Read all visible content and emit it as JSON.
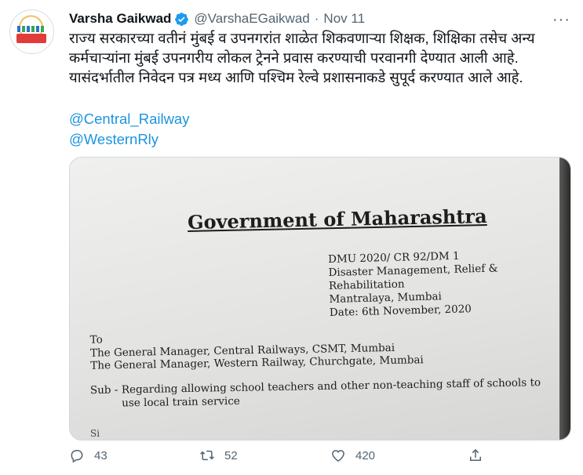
{
  "tweet": {
    "author_name": "Varsha Gaikwad",
    "handle": "@VarshaEGaikwad",
    "separator": "·",
    "date": "Nov 11",
    "more": "···",
    "text": "राज्य सरकारच्या वतीनं मुंबई व उपनगरांत शाळेत शिकवणाऱ्या शिक्षक, शिक्षिका तसेच अन्य कर्मचाऱ्यांना मुंबई उपनगरीय लोकल ट्रेनने प्रवास करण्याची परवानगी देण्यात आली आहे. यासंदर्भातील निवेदन पत्र मध्य आणि पश्चिम रेल्वे प्रशासनाकडे सुपूर्द करण्यात आले आहे.",
    "mentions": [
      "@Central_Railway",
      "@WesternRly"
    ]
  },
  "document": {
    "title": "Government of Maharashtra",
    "ref_lines": [
      "DMU 2020/ CR 92/DM 1",
      "Disaster Management, Relief & Rehabilitation",
      "Mantralaya, Mumbai",
      "Date:  6th November, 2020"
    ],
    "to_label": "To",
    "to_lines": [
      "The General Manager, Central Railways, CSMT, Mumbai",
      "The General Manager, Western Railway, Churchgate, Mumbai"
    ],
    "sub_label": "Sub -",
    "sub_text": "Regarding allowing school teachers and other non-teaching staff of schools to use local train service",
    "cut_text": "Si"
  },
  "actions": {
    "reply_count": "43",
    "retweet_count": "52",
    "like_count": "420"
  },
  "colors": {
    "link": "#1b95e0",
    "muted": "#536471",
    "verified": "#1d9bf0"
  },
  "icons": [
    "verified-badge-icon",
    "more-icon",
    "reply-icon",
    "retweet-icon",
    "like-icon",
    "share-icon"
  ]
}
